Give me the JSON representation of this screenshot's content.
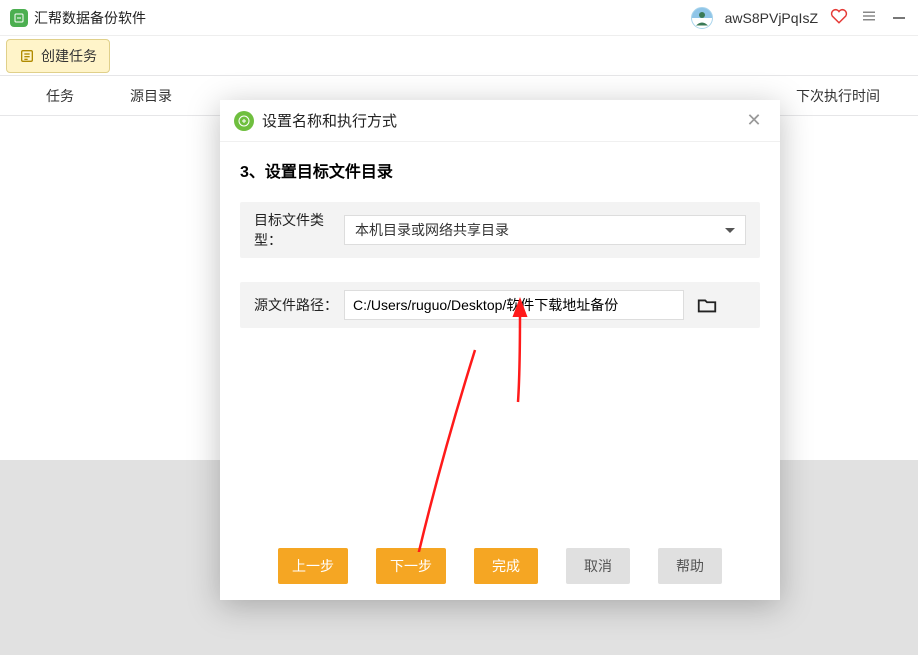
{
  "app": {
    "title": "汇帮数据备份软件",
    "username": "awS8PVjPqIsZ"
  },
  "toolbar": {
    "create_task": "创建任务"
  },
  "columns": {
    "task": "任务",
    "source_dir": "源目录",
    "next_run": "下次执行时间"
  },
  "modal": {
    "title": "设置名称和执行方式",
    "step_heading": "3、设置目标文件目录",
    "label_target_type": "目标文件类型：",
    "target_type_value": "本机目录或网络共享目录",
    "label_source_path": "源文件路径：",
    "source_path_value": "C:/Users/ruguo/Desktop/软件下载地址备份",
    "btn_prev": "上一步",
    "btn_next": "下一步",
    "btn_finish": "完成",
    "btn_cancel": "取消",
    "btn_help": "帮助"
  },
  "colors": {
    "accent_orange": "#f5a623",
    "accent_green": "#4caf50",
    "arrow_red": "#ff1a1a"
  }
}
